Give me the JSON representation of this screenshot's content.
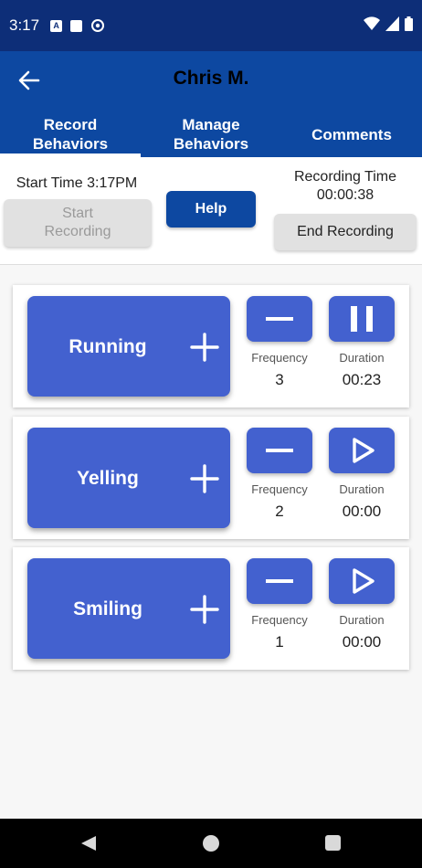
{
  "status_bar": {
    "time": "3:17",
    "left_icons": [
      "a-icon",
      "sd-card-icon",
      "sync-icon"
    ],
    "right_icons": [
      "wifi-icon",
      "signal-icon",
      "battery-icon"
    ]
  },
  "app_bar": {
    "back_icon": "arrow-back-icon",
    "title": "Chris M.",
    "tabs": [
      {
        "label": "Record\nBehaviors",
        "active": true
      },
      {
        "label": "Manage\nBehaviors",
        "active": false
      },
      {
        "label": "Comments",
        "active": false
      }
    ]
  },
  "controls": {
    "start_time": "Start Time 3:17PM",
    "start_recording_label": "Start\nRecording",
    "help_label": "Help",
    "recording_time_label": "Recording Time",
    "recording_time_value": "00:00:38",
    "end_recording_label": "End Recording"
  },
  "behaviors": [
    {
      "name": "Running",
      "frequency_label": "Frequency",
      "frequency": "3",
      "duration_label": "Duration",
      "duration": "00:23",
      "duration_icon": "pause-icon"
    },
    {
      "name": "Yelling",
      "frequency_label": "Frequency",
      "frequency": "2",
      "duration_label": "Duration",
      "duration": "00:00",
      "duration_icon": "play-icon"
    },
    {
      "name": "Smiling",
      "frequency_label": "Frequency",
      "frequency": "1",
      "duration_label": "Duration",
      "duration": "00:00",
      "duration_icon": "play-icon"
    }
  ],
  "colors": {
    "status_bar": "#0d2e78",
    "app_bar": "#0d48a1",
    "behavior_button": "#4361cf",
    "disabled_button": "#e1e1e1"
  },
  "nav_bar": {
    "icons": [
      "nav-back-icon",
      "nav-home-icon",
      "nav-recents-icon"
    ]
  }
}
